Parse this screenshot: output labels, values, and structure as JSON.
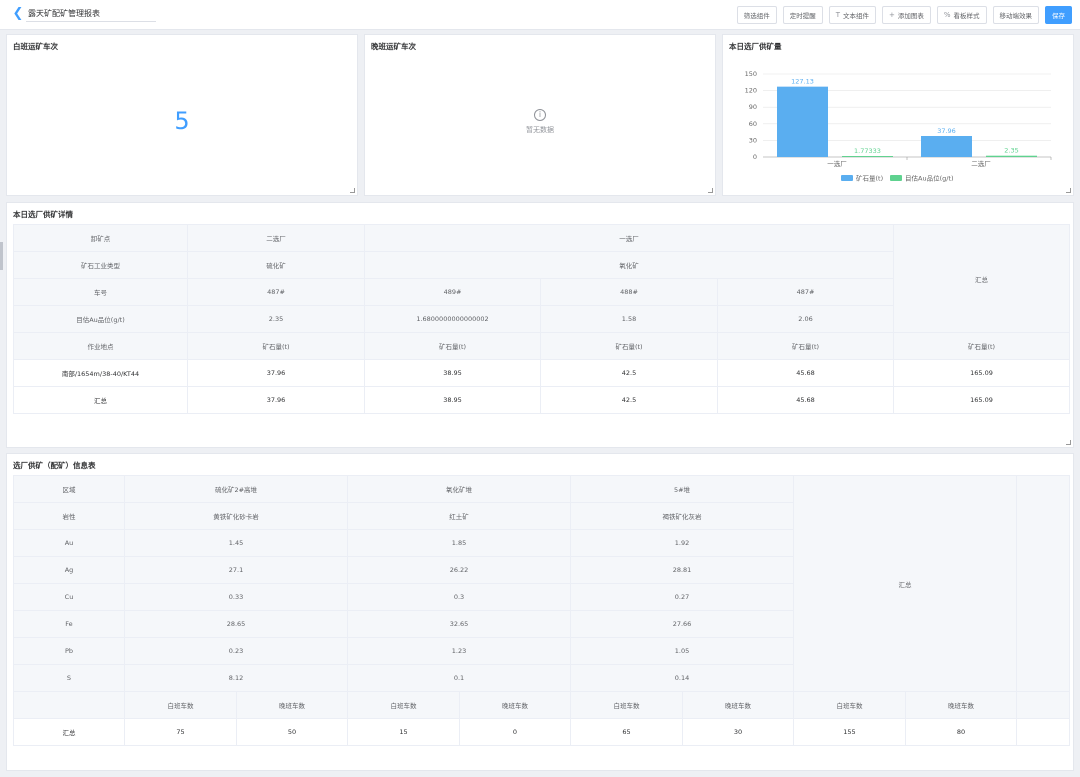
{
  "header": {
    "title": "露天矿配矿管理报表",
    "buttons": [
      {
        "label": "筛选组件",
        "icon": ""
      },
      {
        "label": "定时提醒",
        "icon": ""
      },
      {
        "label": "文本组件",
        "icon": "T"
      },
      {
        "label": "添加图表",
        "icon": "+"
      },
      {
        "label": "看板样式",
        "icon": "%"
      },
      {
        "label": "移动端效果",
        "icon": ""
      },
      {
        "label": "保存",
        "icon": ""
      }
    ]
  },
  "cards": {
    "day_trips": {
      "title": "白班运矿车次",
      "value": "5"
    },
    "night_trips": {
      "title": "晚班运矿车次",
      "empty_text": "暂无数据"
    },
    "supply_chart": {
      "title": "本日选厂供矿量"
    }
  },
  "chart_data": {
    "type": "bar",
    "categories": [
      "一选厂",
      "二选厂"
    ],
    "series": [
      {
        "name": "矿石量(t)",
        "values": [
          127.13,
          37.96
        ],
        "labels": [
          "127.13",
          "37.96"
        ],
        "color": "#5aaef0"
      },
      {
        "name": "目估Au品位(g/t)",
        "values": [
          1.77333,
          2.35
        ],
        "labels": [
          "1.77333",
          "2.35"
        ],
        "color": "#5fd28f"
      }
    ],
    "yticks": [
      "150",
      "120",
      "90",
      "60",
      "30",
      "0"
    ],
    "ylim": [
      0,
      150
    ],
    "grid": true,
    "legend_position": "bottom"
  },
  "table1": {
    "title": "本日选厂供矿详情",
    "summary_label": "汇总",
    "rows": [
      {
        "label": "卸矿点",
        "cells": [
          "二选厂",
          "一选厂"
        ]
      },
      {
        "label": "矿石工业类型",
        "cells": [
          "硫化矿",
          "氧化矿"
        ]
      },
      {
        "label": "车号",
        "cells": [
          "487#",
          "489#",
          "488#",
          "487#"
        ]
      },
      {
        "label": "目估Au品位(g/t)",
        "cells": [
          "2.35",
          "1.6800000000000002",
          "1.58",
          "2.06"
        ]
      },
      {
        "label": "作业地点",
        "cells": [
          "矿石量(t)",
          "矿石量(t)",
          "矿石量(t)",
          "矿石量(t)",
          "矿石量(t)"
        ]
      },
      {
        "label": "南部/1654m/38-40/KT44",
        "cells": [
          "37.96",
          "38.95",
          "42.5",
          "45.68",
          "165.09"
        ]
      },
      {
        "label": "汇总",
        "cells": [
          "37.96",
          "38.95",
          "42.5",
          "45.68",
          "165.09"
        ]
      }
    ]
  },
  "table2": {
    "title": "选厂供矿（配矿）信息表",
    "summary_label": "汇总",
    "rows": [
      {
        "label": "区域",
        "cells": [
          "硫化矿2#高堆",
          "氧化矿堆",
          "5#堆"
        ]
      },
      {
        "label": "岩性",
        "cells": [
          "黄铁矿化砂卡岩",
          "红土矿",
          "褐铁矿化灰岩"
        ]
      },
      {
        "label": "Au",
        "cells": [
          "1.45",
          "1.85",
          "1.92"
        ]
      },
      {
        "label": "Ag",
        "cells": [
          "27.1",
          "26.22",
          "28.81"
        ]
      },
      {
        "label": "Cu",
        "cells": [
          "0.33",
          "0.3",
          "0.27"
        ]
      },
      {
        "label": "Fe",
        "cells": [
          "28.65",
          "32.65",
          "27.66"
        ]
      },
      {
        "label": "Pb",
        "cells": [
          "0.23",
          "1.23",
          "1.05"
        ]
      },
      {
        "label": "S",
        "cells": [
          "8.12",
          "0.1",
          "0.14"
        ]
      },
      {
        "label": "",
        "cells": [
          "白班车数",
          "晚班车数",
          "白班车数",
          "晚班车数",
          "白班车数",
          "晚班车数",
          "白班车数",
          "晚班车数"
        ]
      },
      {
        "label": "汇总",
        "cells": [
          "75",
          "50",
          "15",
          "0",
          "65",
          "30",
          "155",
          "80"
        ]
      }
    ]
  }
}
